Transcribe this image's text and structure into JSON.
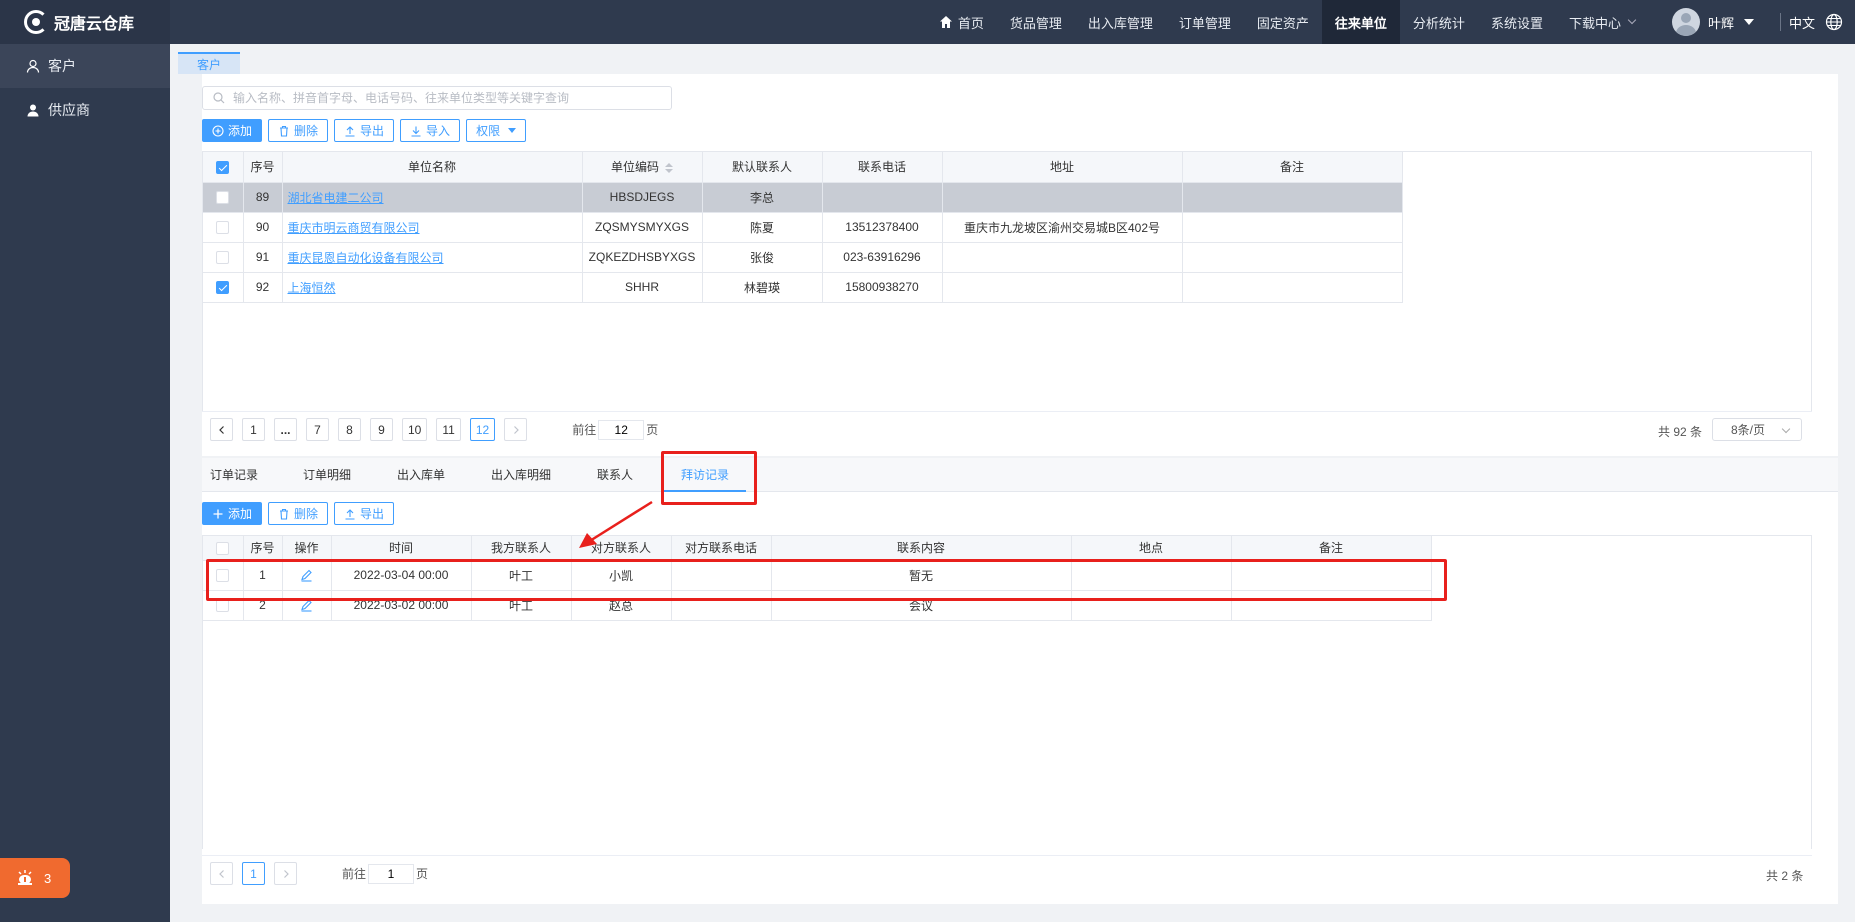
{
  "app": {
    "title": "冠唐云仓库"
  },
  "sidebar": {
    "items": [
      {
        "label": "客户",
        "icon": "user-outline-icon"
      },
      {
        "label": "供应商",
        "icon": "user-filled-icon"
      }
    ],
    "notification_count": "3"
  },
  "topnav": {
    "items": [
      {
        "label": "首页",
        "icon": "home-icon"
      },
      {
        "label": "货品管理"
      },
      {
        "label": "出入库管理"
      },
      {
        "label": "订单管理"
      },
      {
        "label": "固定资产"
      },
      {
        "label": "往来单位",
        "active": true
      },
      {
        "label": "分析统计"
      },
      {
        "label": "系统设置"
      },
      {
        "label": "下载中心"
      }
    ],
    "user_name": "叶辉",
    "language": "中文"
  },
  "page_tab": "客户",
  "top": {
    "search_placeholder": "输入名称、拼音首字母、电话号码、往来单位类型等关键字查询",
    "buttons": {
      "add": "添加",
      "delete": "删除",
      "export": "导出",
      "import": "导入",
      "permission": "权限"
    },
    "columns": [
      "序号",
      "单位名称",
      "单位编码",
      "默认联系人",
      "联系电话",
      "地址",
      "备注"
    ],
    "rows": [
      {
        "no": "89",
        "name": "湖北省电建二公司",
        "code": "HBSDJEGS",
        "contact": "李总",
        "phone": "",
        "address": "",
        "note": "",
        "checked": false,
        "highlight": true
      },
      {
        "no": "90",
        "name": "重庆市明云商贸有限公司",
        "code": "ZQSMYSMYXGS",
        "contact": "陈夏",
        "phone": "13512378400",
        "address": "重庆市九龙坡区渝州交易城B区402号",
        "note": "",
        "checked": false,
        "highlight": false
      },
      {
        "no": "91",
        "name": "重庆昆恩自动化设备有限公司",
        "code": "ZQKEZDHSBYXGS",
        "contact": "张俊",
        "phone": "023-63916296",
        "address": "",
        "note": "",
        "checked": false,
        "highlight": false
      },
      {
        "no": "92",
        "name": "上海恒然",
        "code": "SHHR",
        "contact": "林碧瑛",
        "phone": "15800938270",
        "address": "",
        "note": "",
        "checked": true,
        "highlight": false
      }
    ],
    "pager": {
      "pages": [
        "1",
        "...",
        "7",
        "8",
        "9",
        "10",
        "11",
        "12"
      ],
      "current": "12",
      "goto_label": "前往",
      "goto_value": "12",
      "goto_suffix": "页",
      "total": "共 92 条",
      "page_size": "8条/页"
    }
  },
  "bottom": {
    "tabs": [
      "订单记录",
      "订单明细",
      "出入库单",
      "出入库明细",
      "联系人",
      "拜访记录"
    ],
    "active_tab": "拜访记录",
    "buttons": {
      "add": "添加",
      "delete": "删除",
      "export": "导出"
    },
    "columns": [
      "序号",
      "操作",
      "时间",
      "我方联系人",
      "对方联系人",
      "对方联系电话",
      "联系内容",
      "地点",
      "备注"
    ],
    "rows": [
      {
        "no": "1",
        "time": "2022-03-04 00:00",
        "our_contact": "叶工",
        "their_contact": "小凯",
        "their_phone": "",
        "content": "暂无",
        "place": "",
        "note": ""
      },
      {
        "no": "2",
        "time": "2022-03-02 00:00",
        "our_contact": "叶工",
        "their_contact": "赵总",
        "their_phone": "",
        "content": "会议",
        "place": "",
        "note": ""
      }
    ],
    "pager": {
      "current": "1",
      "goto_label": "前往",
      "goto_value": "1",
      "goto_suffix": "页",
      "total": "共 2 条"
    }
  },
  "colors": {
    "accent": "#409eff",
    "sidebar": "#2f3a4e",
    "annotation": "#e8201c",
    "notify": "#f06a2f"
  }
}
